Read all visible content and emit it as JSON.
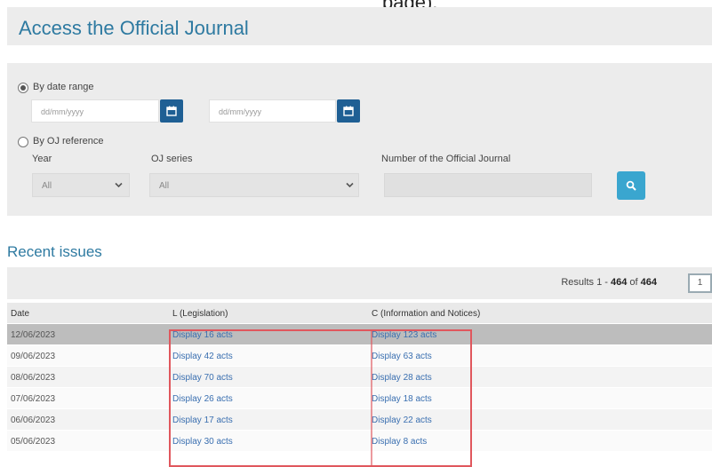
{
  "top_fragment": "page),",
  "header": {
    "title": "Access the Official Journal"
  },
  "search": {
    "by_date_range_label": "By date range",
    "date_from_placeholder": "dd/mm/yyyy",
    "date_to_placeholder": "dd/mm/yyyy",
    "by_oj_reference_label": "By OJ reference",
    "year_label": "Year",
    "year_value": "All",
    "oj_series_label": "OJ series",
    "oj_series_value": "All",
    "oj_number_label": "Number of the Official Journal",
    "oj_number_value": ""
  },
  "recent": {
    "title": "Recent issues",
    "results_prefix": "Results 1 - ",
    "results_count": "464",
    "results_of": " of ",
    "results_total": "464",
    "current_page": "1",
    "columns": [
      "Date",
      "L (Legislation)",
      "C (Information and Notices)"
    ],
    "rows": [
      {
        "date": "12/06/2023",
        "l": "Display 16 acts",
        "c": "Display 123 acts"
      },
      {
        "date": "09/06/2023",
        "l": "Display 42 acts",
        "c": "Display 63 acts"
      },
      {
        "date": "08/06/2023",
        "l": "Display 70 acts",
        "c": "Display 28 acts"
      },
      {
        "date": "07/06/2023",
        "l": "Display 26 acts",
        "c": "Display 18 acts"
      },
      {
        "date": "06/06/2023",
        "l": "Display 17 acts",
        "c": "Display 22 acts"
      },
      {
        "date": "05/06/2023",
        "l": "Display 30 acts",
        "c": "Display 8 acts"
      }
    ]
  },
  "colors": {
    "title_blue": "#2e7aa1",
    "calendar_button": "#1f5f94",
    "search_button": "#3aa6cf",
    "link_blue": "#3a6fb0",
    "highlight_frame": "#e0575d"
  },
  "icons": {
    "calendar": "calendar-icon",
    "search": "search-icon",
    "dropdown": "chevron-down-icon"
  }
}
